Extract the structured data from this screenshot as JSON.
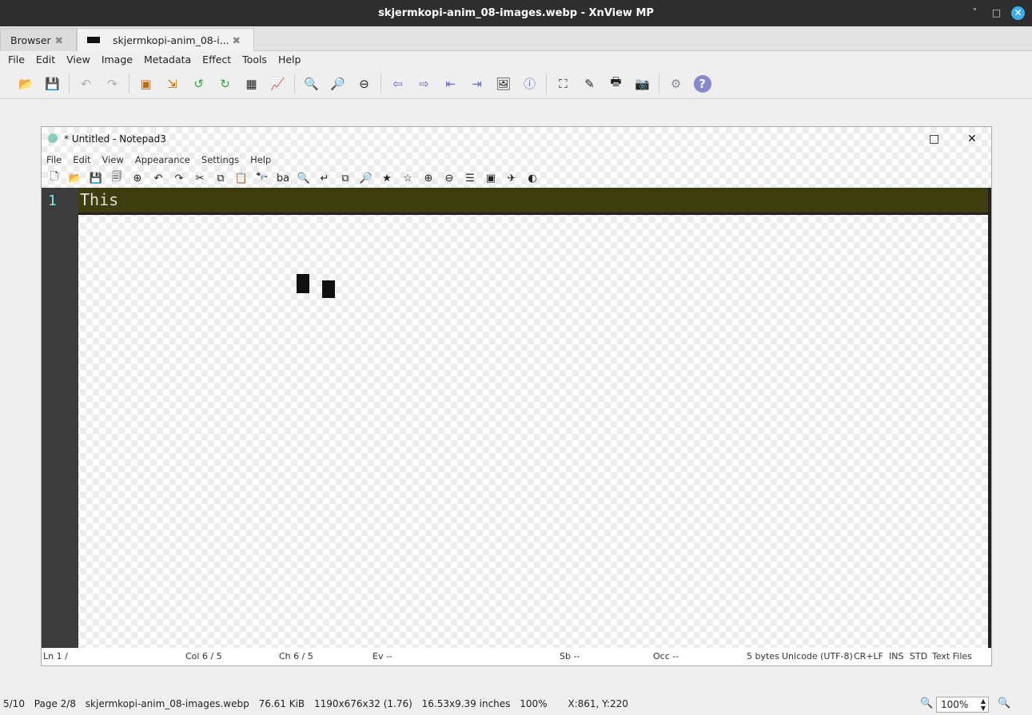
{
  "window": {
    "title": "skjermkopi-anim_08-images.webp - XnView MP",
    "minimize": "˅",
    "maximize": "□",
    "close": "✕"
  },
  "tabs": [
    {
      "label": "Browser",
      "close": "✖"
    },
    {
      "label": "skjermkopi-anim_08-i...",
      "close": "✖"
    }
  ],
  "menu": [
    "File",
    "Edit",
    "View",
    "Image",
    "Metadata",
    "Effect",
    "Tools",
    "Help"
  ],
  "toolbar": [
    "📂",
    "💾",
    "↶",
    "↷",
    "▣",
    "⇲",
    "↺",
    "↻",
    "▦",
    "📈",
    "🔍",
    "🔎",
    "⊖",
    "⇦",
    "⇨",
    "⇤",
    "⇥",
    "🖼",
    "ⓘ",
    "⛶",
    "✎",
    "🖶",
    "📷",
    "⚙",
    "?"
  ],
  "notepad": {
    "title": "* Untitled - Notepad3",
    "menu": [
      "File",
      "Edit",
      "View",
      "Appearance",
      "Settings",
      "Help"
    ],
    "tools": [
      "🗋",
      "📂",
      "💾",
      "🗐",
      "⊕",
      "↶",
      "↷",
      "✂",
      "⧉",
      "📋",
      "🔭",
      "ba",
      "🔍",
      "↵",
      "⧉",
      "🔎",
      "★",
      "☆",
      "⊕",
      "⊖",
      "☰",
      "▣",
      "✈",
      "◐"
    ],
    "line_number": "1",
    "line_text": "This",
    "status": {
      "ln": "Ln 1 / ",
      "col": "Col 6 / 5",
      "ch": "Ch 6 / 5",
      "ev": "Ev -- ",
      "sel": "Sb -- ",
      "occ": "Occ --",
      "size": "5 bytes",
      "enc": "Unicode (UTF-8)",
      "eol": "CR+LF",
      "ins": "INS",
      "std": "STD",
      "lex": "Text Files"
    }
  },
  "status": {
    "index": "5/10",
    "page": "Page 2/8",
    "file": "skjermkopi-anim_08-images.webp",
    "size": "76.61 KiB",
    "dims": "1190x676x32 (1.76)",
    "inches": "16.53x9.39 inches",
    "zoom_pct": "100%",
    "coords": "X:861, Y:220",
    "zoom_value": "100%"
  }
}
